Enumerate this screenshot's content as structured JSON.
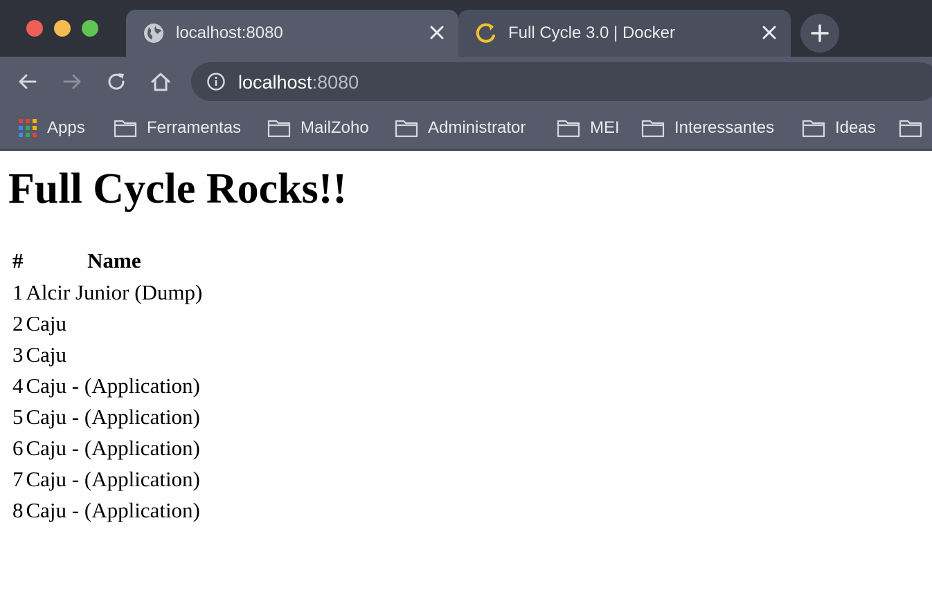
{
  "browser": {
    "tabs": [
      {
        "title": "localhost:8080",
        "favicon": "globe-icon",
        "active": true
      },
      {
        "title": "Full Cycle 3.0 | Docker",
        "favicon": "fullcycle-logo-icon",
        "active": false
      }
    ],
    "address_bar": {
      "host": "localhost",
      "port": ":8080"
    },
    "bookmarks": [
      {
        "label": "Apps",
        "icon": "apps-grid-icon"
      },
      {
        "label": "Ferramentas",
        "icon": "folder-icon"
      },
      {
        "label": "MailZoho",
        "icon": "folder-icon"
      },
      {
        "label": "Administrator",
        "icon": "folder-icon"
      },
      {
        "label": "MEI",
        "icon": "folder-icon"
      },
      {
        "label": "Interessantes",
        "icon": "folder-icon"
      },
      {
        "label": "Ideas",
        "icon": "folder-icon"
      }
    ],
    "colors": {
      "tabstrip": "#2f323b",
      "toolbar": "#555b6a",
      "omnibox": "#414652",
      "fullcycle_logo": "#f2c230"
    }
  },
  "page": {
    "heading": "Full Cycle Rocks!!",
    "table": {
      "headers": [
        "#",
        "Name"
      ],
      "rows": [
        [
          "1",
          "Alcir Junior (Dump)"
        ],
        [
          "2",
          "Caju"
        ],
        [
          "3",
          "Caju"
        ],
        [
          "4",
          "Caju - (Application)"
        ],
        [
          "5",
          "Caju - (Application)"
        ],
        [
          "6",
          "Caju - (Application)"
        ],
        [
          "7",
          "Caju - (Application)"
        ],
        [
          "8",
          "Caju - (Application)"
        ]
      ]
    }
  }
}
